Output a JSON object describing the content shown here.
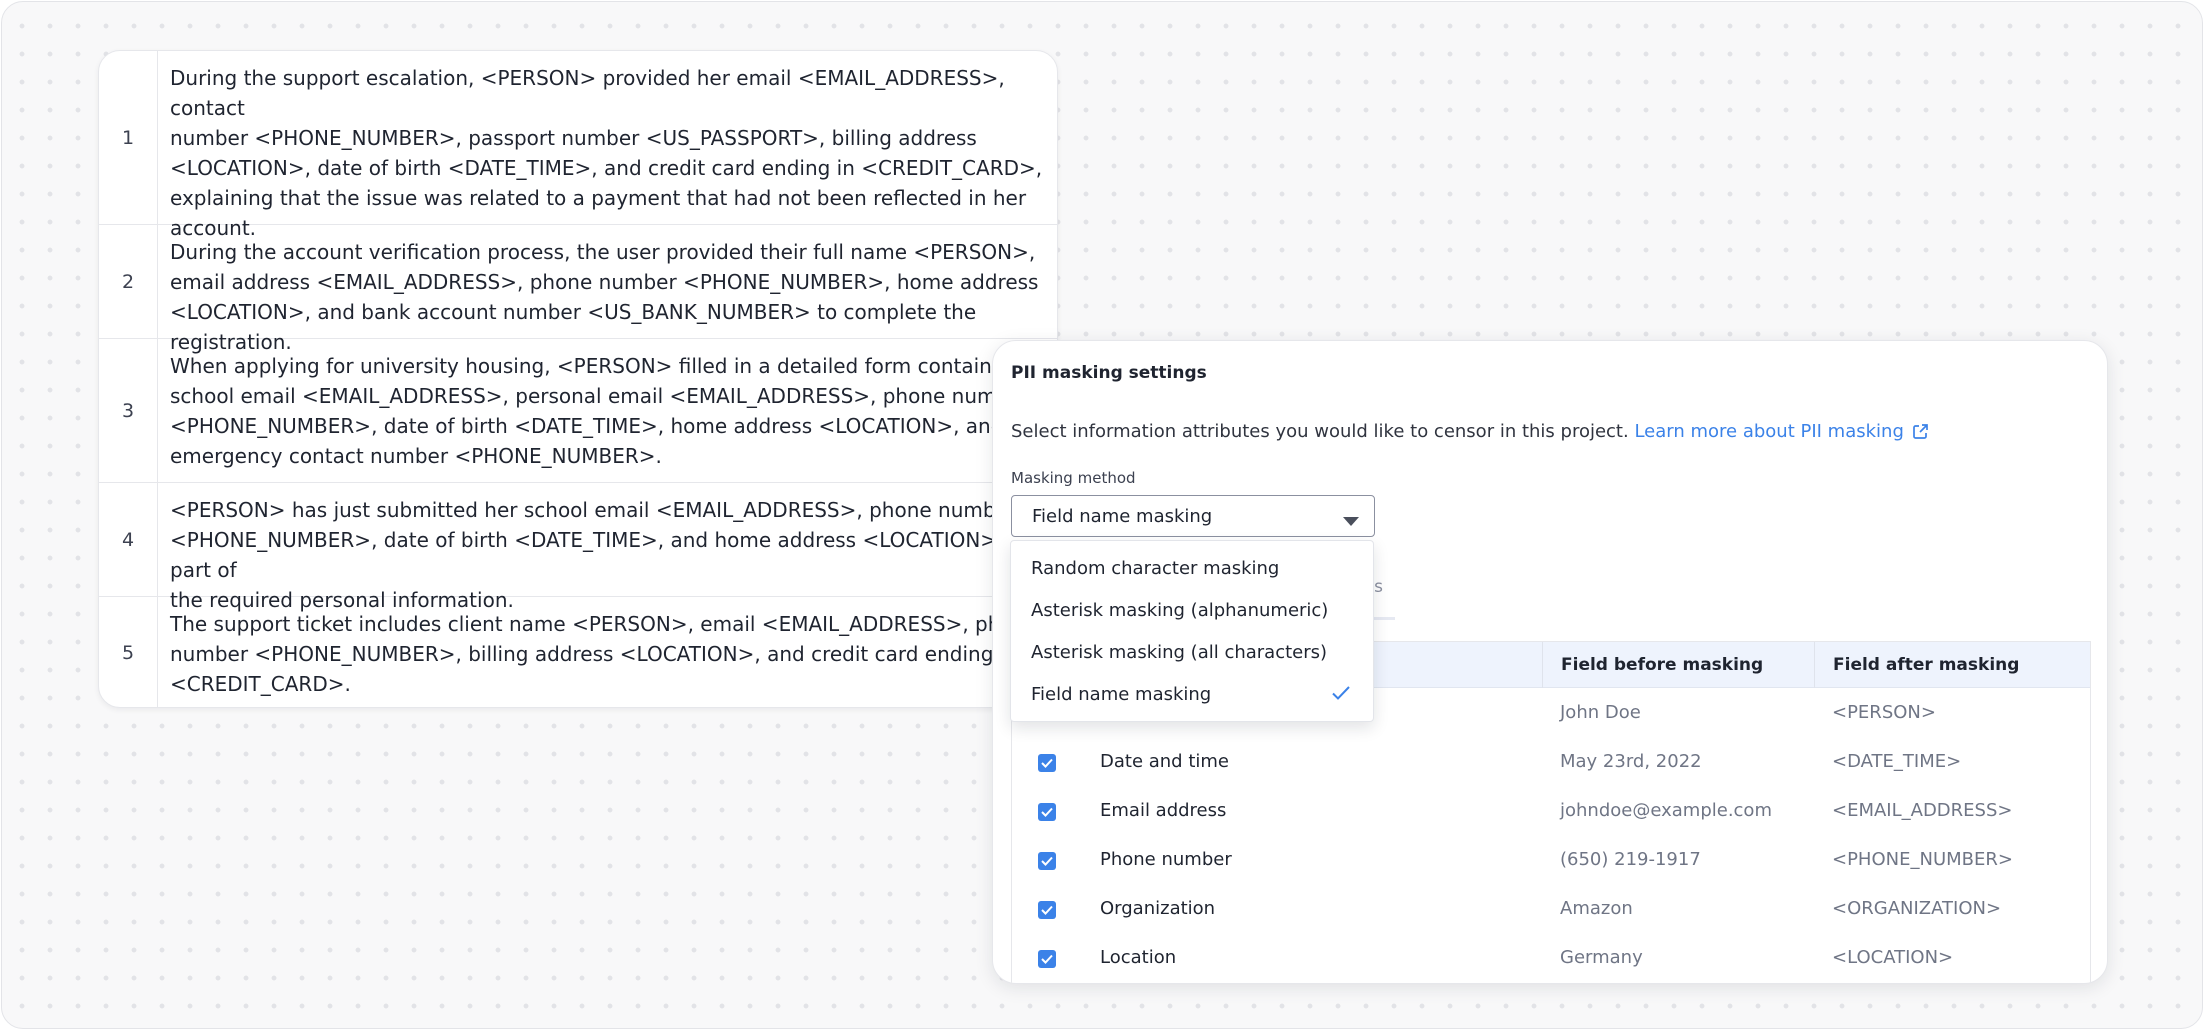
{
  "texts": [
    {
      "num": "1",
      "text": "During the support escalation, <PERSON> provided her email <EMAIL_ADDRESS>, contact\nnumber <PHONE_NUMBER>, passport number <US_PASSPORT>, billing address\n<LOCATION>, date of birth <DATE_TIME>, and credit card ending in <CREDIT_CARD>,\nexplaining that the issue was related to a payment that had not been reflected in her\naccount."
    },
    {
      "num": "2",
      "text": "During the account verification process, the user provided their full name <PERSON>,\nemail address <EMAIL_ADDRESS>, phone number <PHONE_NUMBER>, home address\n<LOCATION>, and bank account number <US_BANK_NUMBER> to complete the registration."
    },
    {
      "num": "3",
      "text": "When applying for university housing, <PERSON> filled in a detailed form containing\nschool email <EMAIL_ADDRESS>, personal email <EMAIL_ADDRESS>, phone number\n<PHONE_NUMBER>, date of birth <DATE_TIME>, home address <LOCATION>, and\nemergency contact number <PHONE_NUMBER>."
    },
    {
      "num": "4",
      "text": "<PERSON> has just submitted her school email <EMAIL_ADDRESS>, phone number\n<PHONE_NUMBER>, date of birth <DATE_TIME>, and home address <LOCATION> as part of\nthe required personal information."
    },
    {
      "num": "5",
      "text": "The support ticket includes client name <PERSON>, email <EMAIL_ADDRESS>, phone\nnumber <PHONE_NUMBER>, billing address <LOCATION>, and credit card ending in\n<CREDIT_CARD>."
    }
  ],
  "panel": {
    "title": "PII masking settings",
    "description": "Select information attributes you would like to censor in this project.",
    "learn_more": "Learn more about PII masking",
    "method_label": "Masking method",
    "selected_method": "Field name masking",
    "tab_peek": "s",
    "table": {
      "col_before": "Field before masking",
      "col_after": "Field after masking",
      "rows": [
        {
          "attr": "",
          "before": "John Doe",
          "after": "<PERSON>",
          "checked": true
        },
        {
          "attr": "Date and time",
          "before": "May 23rd, 2022",
          "after": "<DATE_TIME>",
          "checked": true
        },
        {
          "attr": "Email address",
          "before": "johndoe@example.com",
          "after": "<EMAIL_ADDRESS>",
          "checked": true
        },
        {
          "attr": "Phone number",
          "before": "(650) 219-1917",
          "after": "<PHONE_NUMBER>",
          "checked": true
        },
        {
          "attr": "Organization",
          "before": "Amazon",
          "after": "<ORGANIZATION>",
          "checked": true
        },
        {
          "attr": "Location",
          "before": "Germany",
          "after": "<LOCATION>",
          "checked": true
        }
      ]
    }
  },
  "menu": {
    "options": [
      {
        "label": "Random character masking",
        "selected": false
      },
      {
        "label": "Asterisk masking (alphanumeric)",
        "selected": false
      },
      {
        "label": "Asterisk masking (all characters)",
        "selected": false
      },
      {
        "label": "Field name masking",
        "selected": true
      }
    ]
  },
  "colors": {
    "accent": "#3b82e8",
    "header_bg": "#eef3fd",
    "muted_text": "#6f7585"
  },
  "icons": [
    "caret-down-icon",
    "external-link-icon",
    "checkbox-checked-icon",
    "check-icon"
  ]
}
